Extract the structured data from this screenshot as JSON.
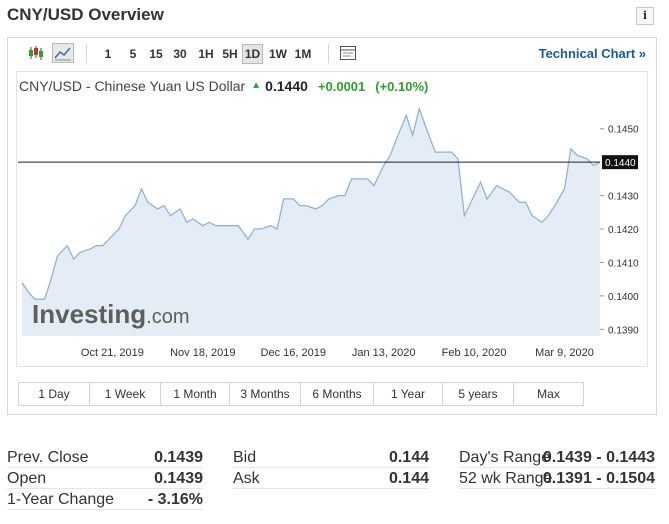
{
  "page": {
    "title": "CNY/USD Overview",
    "info_icon": "i"
  },
  "toolbar": {
    "icons": [
      "candlestick-icon",
      "area-chart-icon"
    ],
    "periods": [
      "1",
      "5",
      "15",
      "30",
      "1H",
      "5H",
      "1D",
      "1W",
      "1M"
    ],
    "active_period": "1D",
    "settings_icon": "chart-settings-icon",
    "technical_link": "Technical Chart »"
  },
  "legend": {
    "name": "CNY/USD - Chinese Yuan US Dollar",
    "direction_icon": "up-arrow-icon",
    "price": "0.1440",
    "change": "+0.0001",
    "change_pct": "(+0.10%)"
  },
  "watermark": {
    "brand": "Investing",
    "suffix": ".com"
  },
  "colors": {
    "line": "#8fb4d6",
    "fill": "#e4edf5",
    "positive": "#2e9e2e",
    "link": "#1a5a96"
  },
  "chart_data": {
    "type": "area",
    "title": "",
    "xlabel": "",
    "ylabel": "",
    "x_tick_labels": [
      "Oct 21, 2019",
      "Nov 18, 2019",
      "Dec 16, 2019",
      "Jan 13, 2020",
      "Feb 10, 2020",
      "Mar 9, 2020"
    ],
    "y_tick_labels": [
      "0.1450",
      "0.1440",
      "0.1430",
      "0.1420",
      "0.1410",
      "0.1400",
      "0.1390"
    ],
    "ylim": [
      0.1388,
      0.1458
    ],
    "x": [
      "2019-09-23",
      "2019-09-25",
      "2019-09-27",
      "2019-09-30",
      "2019-10-02",
      "2019-10-04",
      "2019-10-07",
      "2019-10-09",
      "2019-10-11",
      "2019-10-14",
      "2019-10-16",
      "2019-10-18",
      "2019-10-21",
      "2019-10-23",
      "2019-10-25",
      "2019-10-28",
      "2019-10-30",
      "2019-11-01",
      "2019-11-04",
      "2019-11-06",
      "2019-11-08",
      "2019-11-11",
      "2019-11-13",
      "2019-11-15",
      "2019-11-18",
      "2019-11-20",
      "2019-11-22",
      "2019-11-25",
      "2019-11-27",
      "2019-11-29",
      "2019-12-02",
      "2019-12-04",
      "2019-12-06",
      "2019-12-09",
      "2019-12-11",
      "2019-12-13",
      "2019-12-16",
      "2019-12-18",
      "2019-12-20",
      "2019-12-23",
      "2019-12-25",
      "2019-12-27",
      "2019-12-30",
      "2020-01-01",
      "2020-01-03",
      "2020-01-06",
      "2020-01-08",
      "2020-01-10",
      "2020-01-13",
      "2020-01-15",
      "2020-01-17",
      "2020-01-20",
      "2020-01-22",
      "2020-01-24",
      "2020-01-27",
      "2020-01-29",
      "2020-01-31",
      "2020-02-03",
      "2020-02-05",
      "2020-02-07",
      "2020-02-10",
      "2020-02-12",
      "2020-02-14",
      "2020-02-17",
      "2020-02-19",
      "2020-02-21",
      "2020-02-24",
      "2020-02-26",
      "2020-02-28",
      "2020-03-02",
      "2020-03-04",
      "2020-03-06",
      "2020-03-09",
      "2020-03-11",
      "2020-03-13",
      "2020-03-16",
      "2020-03-18",
      "2020-03-20"
    ],
    "series": [
      {
        "values": [
          0.1404,
          0.1401,
          0.1399,
          0.1399,
          0.1405,
          0.1412,
          0.1415,
          0.1411,
          0.1413,
          0.1414,
          0.1415,
          0.1415,
          0.1418,
          0.142,
          0.1424,
          0.1427,
          0.1432,
          0.1428,
          0.1426,
          0.1427,
          0.1424,
          0.1426,
          0.1422,
          0.1423,
          0.1421,
          0.1422,
          0.1421,
          0.1421,
          0.1421,
          0.1421,
          0.1417,
          0.142,
          0.142,
          0.1421,
          0.142,
          0.1429,
          0.1429,
          0.1427,
          0.1427,
          0.1426,
          0.1427,
          0.1429,
          0.143,
          0.143,
          0.1435,
          0.1435,
          0.1435,
          0.1433,
          0.1439,
          0.1442,
          0.1447,
          0.1454,
          0.1448,
          0.1456,
          0.1448,
          0.1443,
          0.1443,
          0.1443,
          0.1441,
          0.1424,
          0.143,
          0.1434,
          0.1429,
          0.1433,
          0.1432,
          0.1431,
          0.1428,
          0.1428,
          0.1424,
          0.1422,
          0.1424,
          0.1427,
          0.1432,
          0.1444,
          0.1442,
          0.1441,
          0.1439,
          0.144
        ]
      }
    ],
    "current_value": 0.144,
    "current_label": "0.1440",
    "grid": false,
    "legend": "none"
  },
  "ranges": [
    "1 Day",
    "1 Week",
    "1 Month",
    "3 Months",
    "6 Months",
    "1 Year",
    "5 years",
    "Max"
  ],
  "stats": {
    "col1": [
      {
        "label": "Prev. Close",
        "value": "0.1439"
      },
      {
        "label": "Open",
        "value": "0.1439"
      },
      {
        "label": "1-Year Change",
        "value": "- 3.16%"
      }
    ],
    "col2": [
      {
        "label": "Bid",
        "value": "0.144"
      },
      {
        "label": "Ask",
        "value": "0.144"
      }
    ],
    "col3": [
      {
        "label": "Day's Range",
        "value": "0.1439 - 0.1443"
      },
      {
        "label": "52 wk Range",
        "value": "0.1391 - 0.1504"
      }
    ]
  }
}
